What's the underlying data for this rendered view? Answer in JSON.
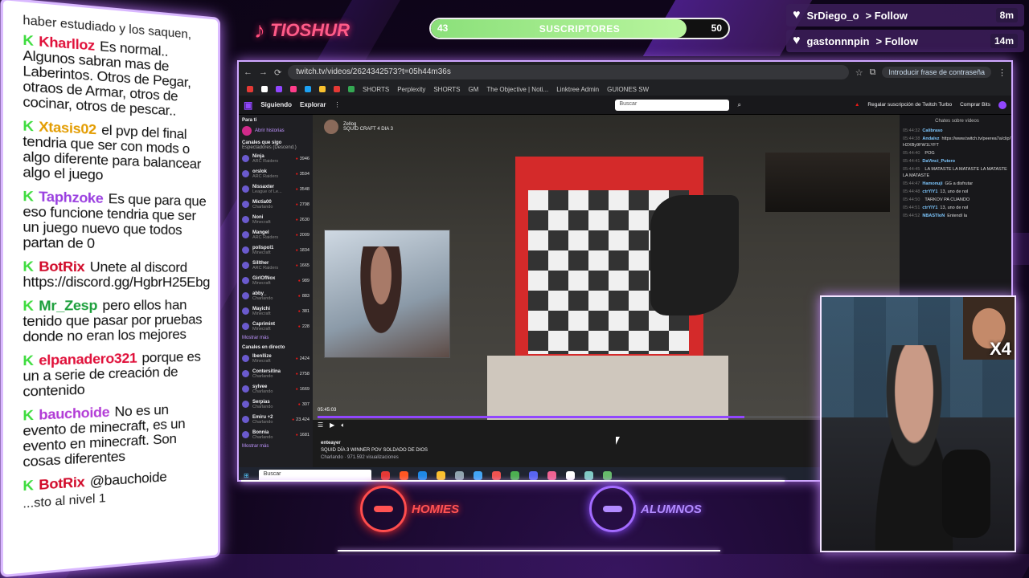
{
  "tiktok": {
    "name": "TIOSHUR",
    "icon": "tiktok-icon"
  },
  "subs": {
    "current": "43",
    "label": "SUSCRIPTORES",
    "goal": "50",
    "progress": 0.86
  },
  "follows": [
    {
      "user": "SrDiego_o",
      "action": "> Follow",
      "ago": "8m"
    },
    {
      "user": "gastonnnpin",
      "action": "> Follow",
      "ago": "14m"
    }
  ],
  "chat": {
    "top_text": "haber estudiado y los saquen,",
    "messages": [
      {
        "user": "Kharlloz",
        "color": "#e0103a",
        "text": "Es normal.. Algunos sabran mas de Laberintos. Otros de Pegar, otraos de Armar, otros de cocinar, otros de pescar.."
      },
      {
        "user": "Xtasis02",
        "color": "#e39c00",
        "text": "el pvp del final tendria que ser con mods o algo diferente para balancear algo el juego"
      },
      {
        "user": "Taphzoke",
        "color": "#9a3fe0",
        "text": "Es que para que eso funcione tendria que ser un juego nuevo que todos partan de 0"
      },
      {
        "user": "BotRix",
        "color": "#d10a2a",
        "text": "Unete al discord https://discord.gg/HgbrH25Ebg"
      },
      {
        "user": "Mr_Zesp",
        "color": "#1a9e3a",
        "text": "pero ellos han tenido que pasar por pruebas donde no eran los mejores"
      },
      {
        "user": "elpanadero321",
        "color": "#e0103a",
        "text": "porque es un a serie de creación de contenido"
      },
      {
        "user": "bauchoide",
        "color": "#b23bd6",
        "text": "No es un evento de minecraft, es un evento en minecraft. Son cosas diferentes"
      },
      {
        "user": "BotRix",
        "color": "#d10a2a",
        "text": "@bauchoide"
      }
    ],
    "bottom_text": "...sto al nivel 1"
  },
  "browser": {
    "url": "twitch.tv/videos/2624342573?t=05h44m36s",
    "password_chip": "Introducir frase de contraseña",
    "bookmarks": [
      "SHORTS",
      "Perplexity",
      "SHORTS",
      "GM",
      "The Objective | Noti...",
      "Linktree Admin",
      "GUIONES SW"
    ],
    "twitch": {
      "nav": [
        "Siguiendo",
        "Explorar"
      ],
      "search_placeholder": "Buscar",
      "right": [
        "Regalar suscripción de Twitch Turbo",
        "Comprar Bits"
      ],
      "sidebar": {
        "title": "Para ti",
        "history": "Abrir historias",
        "follow_header": "Canales que sigo",
        "follow_sub": "Espectadores (Descend.)",
        "channels": [
          {
            "name": "Ninja",
            "game": "ARC Raiders",
            "viewers": "3946"
          },
          {
            "name": "orslok",
            "game": "ARC Raiders",
            "viewers": "3594"
          },
          {
            "name": "Nissaxter",
            "game": "League of Le...",
            "viewers": "3548"
          },
          {
            "name": "Mictia00",
            "game": "Charlando",
            "viewers": "2798"
          },
          {
            "name": "Noni",
            "game": "Minecraft",
            "viewers": "2630"
          },
          {
            "name": "Mangel",
            "game": "ARC Raiders",
            "viewers": "2009"
          },
          {
            "name": "polispol1",
            "game": "Minecraft",
            "viewers": "1834"
          },
          {
            "name": "Sillther",
            "game": "ARC Raiders",
            "viewers": "1665"
          },
          {
            "name": "GirlOfNox",
            "game": "Minecraft",
            "viewers": "989"
          },
          {
            "name": "abby_",
            "game": "Charlando",
            "viewers": "883"
          },
          {
            "name": "Mayichi",
            "game": "Minecraft",
            "viewers": "381"
          },
          {
            "name": "Caprimint",
            "game": "Minecraft",
            "viewers": "228"
          }
        ],
        "more": "Mostrar más",
        "live_header": "Canales en directo",
        "live": [
          {
            "name": "Ibenllize",
            "game": "Minecraft",
            "viewers": "2424"
          },
          {
            "name": "Contersitina",
            "game": "Charlando",
            "viewers": "2758"
          },
          {
            "name": "sylvee",
            "game": "Charlando",
            "viewers": "1669"
          },
          {
            "name": "Serpias",
            "game": "Charlando",
            "viewers": "307"
          },
          {
            "name": "Emiru +2",
            "game": "Charlando",
            "viewers": "23.424"
          },
          {
            "name": "Bonnia",
            "game": "Charlando",
            "viewers": "1681"
          }
        ],
        "more2": "Mostrar más"
      },
      "video": {
        "streamer": "Zellog",
        "stream_title": "SQUID CRAFT 4 DIA 3",
        "time": "05:45:03",
        "progress": 0.74,
        "channel": "enteayer",
        "title": "SQUID DÍA 3 WINNER POV SOLDADO DE DIOS",
        "meta": "Charlando · 971.592 visualizaciones"
      },
      "chat": {
        "header": "Chates sobre videos",
        "lines": [
          {
            "t": "05:44:32",
            "u": "Calibraso",
            "m": ""
          },
          {
            "t": "05:44:38",
            "u": "Andalvz",
            "m": "https://www.twitch.tv/peerea7a/clip/Th H2XBy9FW1LYFT"
          },
          {
            "t": "05:44:40",
            "u": "",
            "m": "POG"
          },
          {
            "t": "05:44:41",
            "u": "DaVinci_Putero",
            "m": ""
          },
          {
            "t": "05:44:45",
            "u": "",
            "m": "LA MATASTE LA MATASTE LA MATASTE LA MATASTE"
          },
          {
            "t": "05:44:47",
            "u": "Hamonuji",
            "m": "GG a disfrutar"
          },
          {
            "t": "05:44:48",
            "u": "ctrYlY1",
            "m": "13, uno de nol"
          },
          {
            "t": "05:44:50",
            "u": "",
            "m": "TARKOV PA CUANDO"
          },
          {
            "t": "05:44:51",
            "u": "ctrYlY1",
            "m": "13, uno de nol"
          },
          {
            "t": "05:44:52",
            "u": "NBASTIoN",
            "m": "Entendí la"
          }
        ]
      }
    },
    "taskbar_search": "Buscar"
  },
  "logos": {
    "homies": "HOMIES",
    "alumnos": "ALUMNOS"
  },
  "facecam": {
    "multiplier": "X4"
  }
}
